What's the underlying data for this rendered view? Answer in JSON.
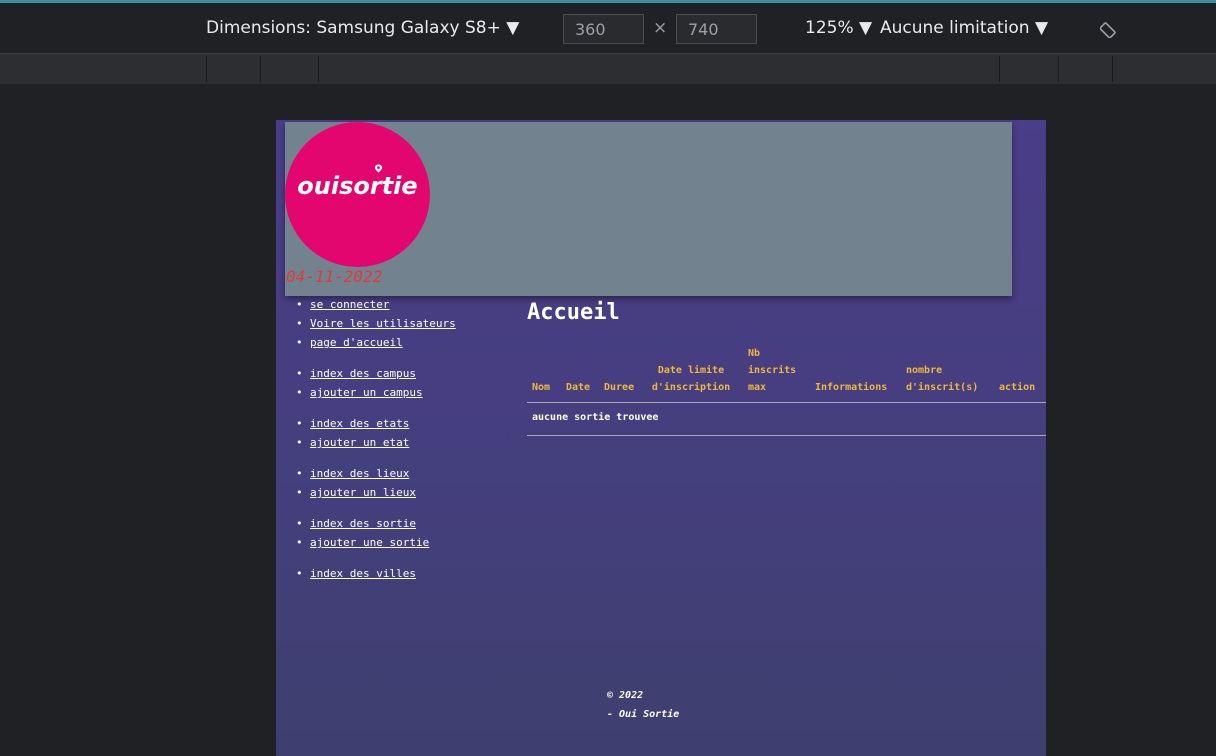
{
  "devtools": {
    "dimensions_label": "Dimensions: Samsung Galaxy S8+ ▼",
    "width_value": "360",
    "times": "×",
    "height_value": "740",
    "zoom_label": "125% ▼",
    "throttle_label": "Aucune limitation ▼",
    "rotate_icon": "rotate-icon"
  },
  "site": {
    "logo_text": "ouisortie",
    "logo_color": "#e4066f",
    "date": "04-11-2022",
    "nav_groups": [
      [
        "se connecter",
        "Voire les utilisateurs",
        "page d'accueil"
      ],
      [
        "index des campus",
        "ajouter un campus"
      ],
      [
        "index des etats",
        "ajouter un etat"
      ],
      [
        "index des lieux",
        "ajouter un lieux"
      ],
      [
        "index des sortie",
        "ajouter une sortie"
      ],
      [
        "index des villes"
      ]
    ],
    "page_title": "Accueil",
    "table": {
      "headers": [
        "Nom",
        "Date",
        "Duree",
        "Date limite d'inscription",
        "Nb inscrits max",
        "Informations",
        "nombre d'inscrit(s)",
        "action"
      ],
      "empty_message": "aucune sortie trouvee"
    },
    "footer": {
      "copyright": "© 2022",
      "name": "- Oui Sortie"
    }
  }
}
